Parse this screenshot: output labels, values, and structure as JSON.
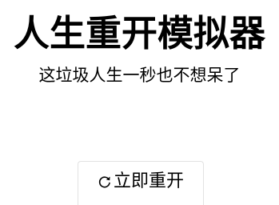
{
  "app": {
    "title": "人生重开模拟器",
    "subtitle": "这垃圾人生一秒也不想呆了"
  },
  "restart_button": {
    "label": "立即重开",
    "icon": "restart-icon"
  },
  "colors": {
    "background": "#ffffff",
    "text": "#000000",
    "button_border": "#e2e2e2"
  }
}
